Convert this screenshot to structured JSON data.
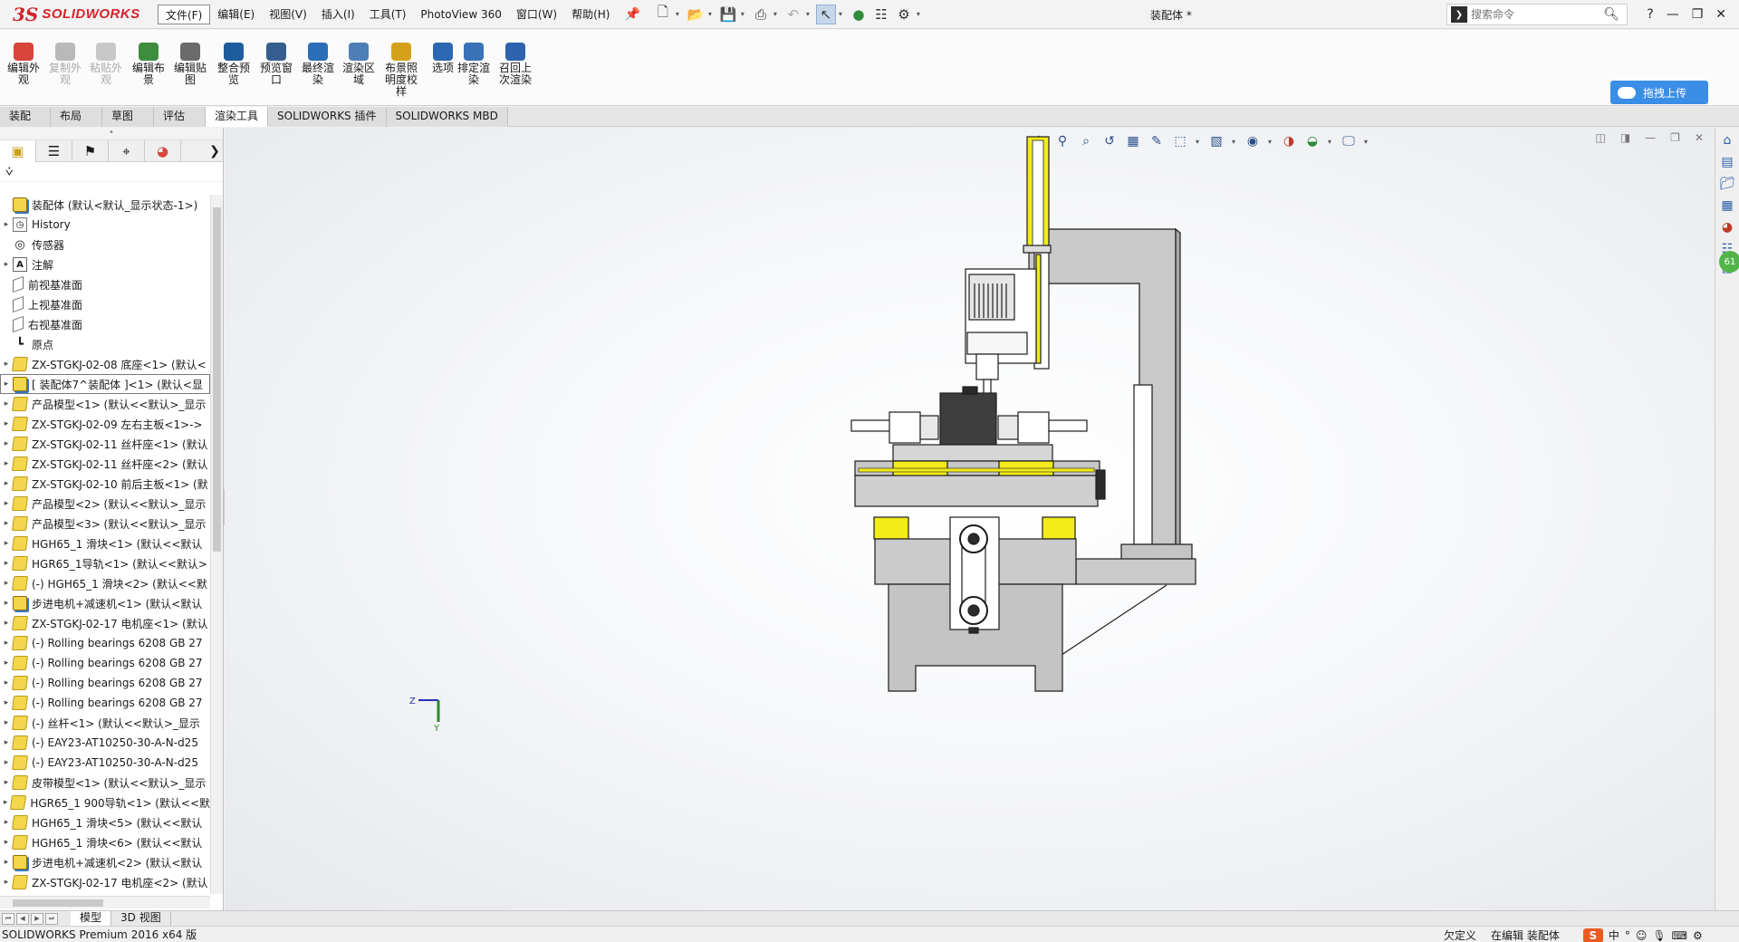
{
  "app": {
    "logo_prefix": "3S",
    "logo_text": "SOLIDWORKS",
    "menus": [
      "文件(F)",
      "编辑(E)",
      "视图(V)",
      "插入(I)",
      "工具(T)",
      "PhotoView 360",
      "窗口(W)",
      "帮助(H)"
    ],
    "doc_title": "装配体 *",
    "search_placeholder": "搜索命令",
    "help_label": "?"
  },
  "ribbon": {
    "buttons": [
      {
        "label": "编辑外观",
        "enabled": true,
        "color": "#d9453b"
      },
      {
        "label": "复制外观",
        "enabled": false,
        "color": "#b9b9b9"
      },
      {
        "label": "粘贴外观",
        "enabled": false,
        "color": "#c8c8c8"
      },
      {
        "label": "编辑布景",
        "enabled": true,
        "color": "#3d8d3d"
      },
      {
        "label": "编辑贴图",
        "enabled": true,
        "color": "#6b6b6b"
      },
      {
        "label": "整合预览",
        "enabled": true,
        "color": "#1d5d9e"
      },
      {
        "label": "预览窗口",
        "enabled": true,
        "color": "#355e8f"
      },
      {
        "label": "最终渲染",
        "enabled": true,
        "color": "#2a6eb8"
      },
      {
        "label": "渲染区域",
        "enabled": true,
        "color": "#4d7fb6"
      },
      {
        "label": "布景照明度校样",
        "enabled": true,
        "color": "#d4a21a"
      },
      {
        "label": "选项",
        "enabled": true,
        "color": "#2c67b1"
      },
      {
        "label": "排定渲染",
        "enabled": true,
        "color": "#3a72b8"
      },
      {
        "label": "召回上次渲染",
        "enabled": true,
        "color": "#2e64ad"
      }
    ],
    "cloud_button": "拖拽上传"
  },
  "tabs": [
    "装配体",
    "布局",
    "草图",
    "评估",
    "渲染工具",
    "SOLIDWORKS 插件",
    "SOLIDWORKS MBD"
  ],
  "active_tab": "渲染工具",
  "tree": {
    "root": "装配体  (默认<默认_显示状态-1>)",
    "items": [
      {
        "label": "History",
        "icon": "history-icon",
        "expandable": true
      },
      {
        "label": "传感器",
        "icon": "sensor-icon",
        "expandable": false
      },
      {
        "label": "注解",
        "icon": "annotation-icon",
        "expandable": true
      },
      {
        "label": "前视基准面",
        "icon": "plane-icon",
        "expandable": false
      },
      {
        "label": "上视基准面",
        "icon": "plane-icon",
        "expandable": false
      },
      {
        "label": "右视基准面",
        "icon": "plane-icon",
        "expandable": false
      },
      {
        "label": "原点",
        "icon": "origin-icon",
        "expandable": false
      },
      {
        "label": "ZX-STGKJ-02-08 底座<1> (默认<",
        "icon": "part-icon",
        "expandable": true
      },
      {
        "label": "[ 装配体7^装配体 ]<1> (默认<显",
        "icon": "assembly-icon",
        "expandable": true,
        "selected": true
      },
      {
        "label": "产品模型<1> (默认<<默认>_显示",
        "icon": "part-icon",
        "expandable": true
      },
      {
        "label": "ZX-STGKJ-02-09 左右主板<1>->",
        "icon": "part-icon",
        "expandable": true
      },
      {
        "label": "ZX-STGKJ-02-11 丝杆座<1> (默认",
        "icon": "part-icon",
        "expandable": true
      },
      {
        "label": "ZX-STGKJ-02-11 丝杆座<2> (默认",
        "icon": "part-icon",
        "expandable": true
      },
      {
        "label": "ZX-STGKJ-02-10 前后主板<1> (默",
        "icon": "part-icon",
        "expandable": true
      },
      {
        "label": "产品模型<2> (默认<<默认>_显示",
        "icon": "part-icon",
        "expandable": true
      },
      {
        "label": "产品模型<3> (默认<<默认>_显示",
        "icon": "part-icon",
        "expandable": true
      },
      {
        "label": "HGH65_1 滑块<1> (默认<<默认",
        "icon": "part-icon",
        "expandable": true
      },
      {
        "label": "HGR65_1导轨<1> (默认<<默认>",
        "icon": "part-icon",
        "expandable": true
      },
      {
        "label": "(-) HGH65_1 滑块<2> (默认<<默",
        "icon": "part-icon",
        "expandable": true
      },
      {
        "label": "步进电机+减速机<1> (默认<默认",
        "icon": "assembly-icon",
        "expandable": true
      },
      {
        "label": "ZX-STGKJ-02-17 电机座<1> (默认",
        "icon": "part-icon",
        "expandable": true
      },
      {
        "label": "(-) Rolling bearings 6208 GB 27",
        "icon": "part-icon",
        "expandable": true
      },
      {
        "label": "(-) Rolling bearings 6208 GB 27",
        "icon": "part-icon",
        "expandable": true
      },
      {
        "label": "(-) Rolling bearings 6208 GB 27",
        "icon": "part-icon",
        "expandable": true
      },
      {
        "label": "(-) Rolling bearings 6208 GB 27",
        "icon": "part-icon",
        "expandable": true
      },
      {
        "label": "(-) 丝杆<1> (默认<<默认>_显示",
        "icon": "part-icon",
        "expandable": true
      },
      {
        "label": "(-) EAY23-AT10250-30-A-N-d25",
        "icon": "part-icon",
        "expandable": true
      },
      {
        "label": "(-) EAY23-AT10250-30-A-N-d25",
        "icon": "part-icon",
        "expandable": true
      },
      {
        "label": "皮带模型<1> (默认<<默认>_显示",
        "icon": "part-icon",
        "expandable": true
      },
      {
        "label": "HGR65_1 900导轨<1> (默认<<默",
        "icon": "part-icon",
        "expandable": true
      },
      {
        "label": "HGH65_1 滑块<5> (默认<<默认",
        "icon": "part-icon",
        "expandable": true
      },
      {
        "label": "HGH65_1 滑块<6> (默认<<默认",
        "icon": "part-icon",
        "expandable": true
      },
      {
        "label": "步进电机+减速机<2> (默认<默认",
        "icon": "assembly-icon",
        "expandable": true
      },
      {
        "label": "ZX-STGKJ-02-17 电机座<2> (默认",
        "icon": "part-icon",
        "expandable": true
      }
    ]
  },
  "bottom_tabs": [
    "模型",
    "3D 视图"
  ],
  "status": {
    "left": "SOLIDWORKS Premium 2016 x64 版",
    "state": "欠定义",
    "mode": "在编辑 装配体",
    "ime_logo": "S",
    "ime_lang": "中"
  },
  "triad": {
    "z": "Z",
    "y": "Y"
  },
  "task_pane_badge": "61",
  "colors": {
    "accent": "#3a8ee6",
    "brand_red": "#d2232a",
    "model_gray": "#c8c8c8",
    "model_yellow": "#f2ec1a",
    "viewport_bg": "#f6f7f9"
  }
}
